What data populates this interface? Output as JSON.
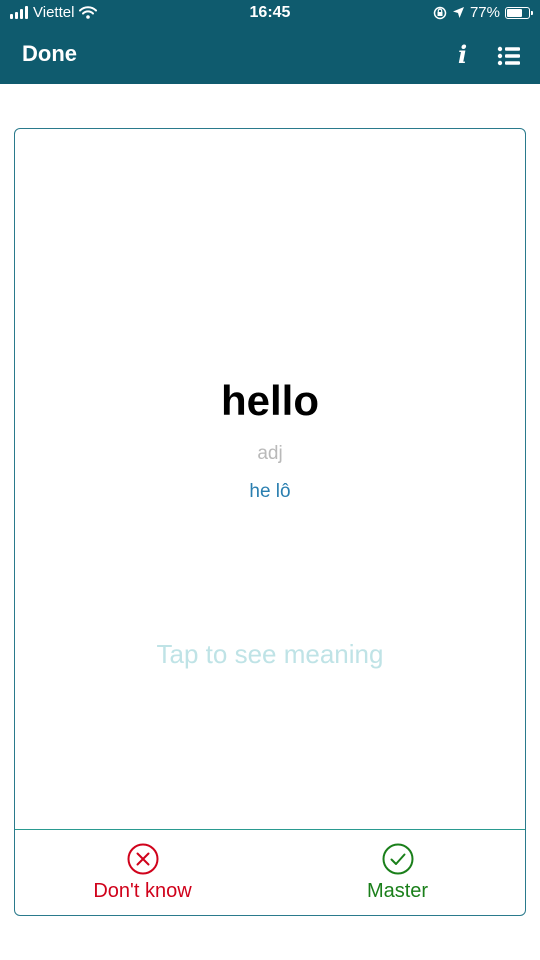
{
  "status_bar": {
    "carrier": "Viettel",
    "time": "16:45",
    "battery": "77%",
    "battery_level": 0.77
  },
  "nav": {
    "done_label": "Done"
  },
  "card": {
    "word": "hello",
    "part_of_speech": "adj",
    "pronunciation": "he lô",
    "hint": "Tap to see meaning"
  },
  "actions": {
    "dont_know": "Don't know",
    "master": "Master"
  },
  "colors": {
    "header": "#0f5b6e",
    "dont_know": "#d0021b",
    "master": "#1a7f1a",
    "pronunciation": "#2a7fb0"
  },
  "icons": [
    "signal-icon",
    "wifi-icon",
    "rotation-lock-icon",
    "location-arrow-icon",
    "battery-icon",
    "info-icon",
    "list-icon",
    "close-circle-icon",
    "check-circle-icon"
  ]
}
